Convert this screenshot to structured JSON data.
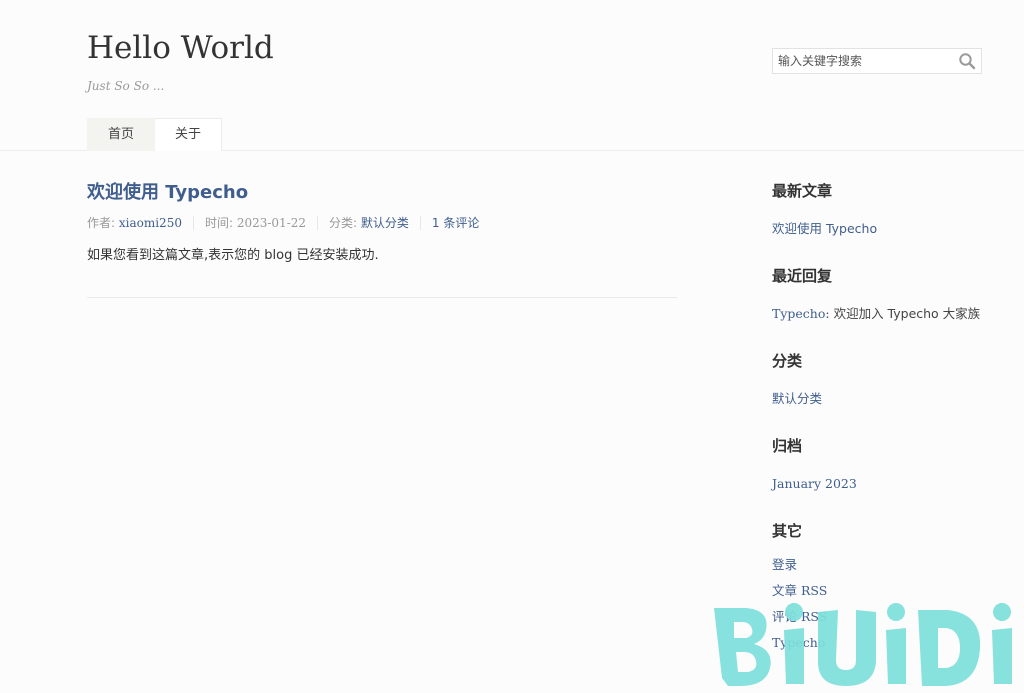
{
  "header": {
    "title": "Hello World",
    "description": "Just So So ...",
    "search": {
      "placeholder": "输入关键字搜索",
      "value": ""
    },
    "nav": [
      {
        "label": "首页",
        "active": true
      },
      {
        "label": "关于",
        "active": false
      }
    ]
  },
  "post": {
    "title": "欢迎使用 Typecho",
    "meta": {
      "author_label": "作者: ",
      "author": "xiaomi250",
      "date_label": "时间: ",
      "date": "2023-01-22",
      "category_label": "分类: ",
      "category": "默认分类",
      "comments": "1 条评论"
    },
    "excerpt": "如果您看到这篇文章,表示您的 blog 已经安装成功."
  },
  "sidebar": {
    "recent_posts": {
      "title": "最新文章",
      "items": [
        "欢迎使用 Typecho"
      ]
    },
    "recent_comments": {
      "title": "最近回复",
      "items": [
        {
          "author": "Typecho",
          "separator": ": ",
          "text": "欢迎加入 Typecho 大家族"
        }
      ]
    },
    "categories": {
      "title": "分类",
      "items": [
        "默认分类"
      ]
    },
    "archives": {
      "title": "归档",
      "items": [
        "January 2023"
      ]
    },
    "other": {
      "title": "其它",
      "items": [
        "登录",
        "文章 RSS",
        "评论 RSS",
        "Typecho"
      ]
    }
  },
  "watermark": {
    "text": "BiUiDi",
    "color": "#7de0dc"
  },
  "colors": {
    "link": "#3f5e8e",
    "text": "#444444",
    "muted": "#999999",
    "background": "#fdfcfc"
  },
  "icons": {
    "search": "search-icon"
  }
}
